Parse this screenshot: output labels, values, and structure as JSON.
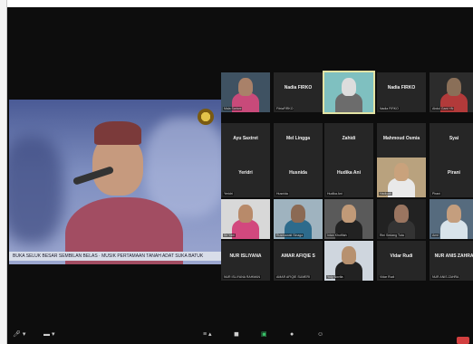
{
  "shared_screen": {
    "ticker_text": "BUKA SELUK BESAR SEMBILAN BELAS · MUSIK PERTAMAAN TANAH ADAT SUKA BATUK"
  },
  "gallery": [
    {
      "name": "",
      "sub": "Mala Sariani",
      "photo": true,
      "bg": "#3f5262",
      "skin": "#a98169",
      "shirt": "#c84a7a"
    },
    {
      "name": "Nadia FIRKO",
      "sub": "FitriaFIRKO",
      "photo": false
    },
    {
      "name": "",
      "sub": "",
      "photo": true,
      "bg": "#7fc0c0",
      "skin": "#ddd",
      "shirt": "#6c6c6c",
      "active": true
    },
    {
      "name": "Nadia FIRKO",
      "sub": "Nadia FIRKO",
      "photo": false
    },
    {
      "name": "",
      "sub": "Abdul Gani HN",
      "photo": true,
      "bg": "#2c2c2c",
      "skin": "#8a6f58",
      "shirt": "#b23a3a"
    },
    {
      "name": "Ayu Saxtret",
      "sub": "Ayu Saxtret",
      "photo": false
    },
    {
      "name": "Mel Lingga",
      "sub": "Mel Lingga",
      "photo": false
    },
    {
      "name": "Zahidi",
      "sub": "Zahidi",
      "photo": false
    },
    {
      "name": "Mahmoud Osmia",
      "sub": "Mahmoud Osmia",
      "photo": false
    },
    {
      "name": "Syai",
      "sub": "Syai",
      "photo": false
    },
    {
      "name": "Yeridri",
      "sub": "Yeridri",
      "photo": false
    },
    {
      "name": "Husnida",
      "sub": "Husnida",
      "photo": false
    },
    {
      "name": "Hudika Ani",
      "sub": "Hudika Ani",
      "photo": false
    },
    {
      "name": "",
      "sub": "Hadiyah",
      "photo": true,
      "bg": "#b9a27e",
      "skin": "#c9a27c",
      "shirt": "#e9e9e9"
    },
    {
      "name": "Pirani",
      "sub": "Pirani",
      "photo": false
    },
    {
      "name": "",
      "sub": "Sri Yani",
      "photo": true,
      "bg": "#d8d8d8",
      "skin": "#b88a6a",
      "shirt": "#d2487e"
    },
    {
      "name": "",
      "sub": "Rusmawati Sinaga",
      "photo": true,
      "bg": "#9fb3bf",
      "skin": "#8b6a54",
      "shirt": "#2d6b8c"
    },
    {
      "name": "",
      "sub": "Intan Khofifah",
      "photo": true,
      "bg": "#5a5a5a",
      "skin": "#c19a78",
      "shirt": "#222"
    },
    {
      "name": "",
      "sub": "Rini Sedang Tuta",
      "photo": true,
      "bg": "#222",
      "skin": "#9a7560",
      "shirt": "#333"
    },
    {
      "name": "",
      "sub": "Amri",
      "photo": true,
      "bg": "#566b7e",
      "skin": "#c49e7e",
      "shirt": "#d8e3ea"
    },
    {
      "name": "NUR ISLIYANA",
      "sub": "NUR ISLIYANA RAHMAN",
      "photo": false
    },
    {
      "name": "AMAR AFIQIE S",
      "sub": "AMAR AFIQIE SUMERI",
      "photo": false
    },
    {
      "name": "",
      "sub": "Yuly Novita",
      "photo": true,
      "bg": "#cfd6de",
      "skin": "#b7916f",
      "shirt": "#222"
    },
    {
      "name": "Vidar Rudi",
      "sub": "Vidar Rudi",
      "photo": false
    },
    {
      "name": "NUR ANIS ZAHRA",
      "sub": "NUR ANIS ZAHRA",
      "photo": false
    }
  ],
  "toolbar": {
    "mic_icon": "mic-icon",
    "video_icon": "video-icon",
    "icons": [
      "participants-icon",
      "chat-icon",
      "share-icon",
      "record-icon",
      "reactions-icon"
    ]
  }
}
